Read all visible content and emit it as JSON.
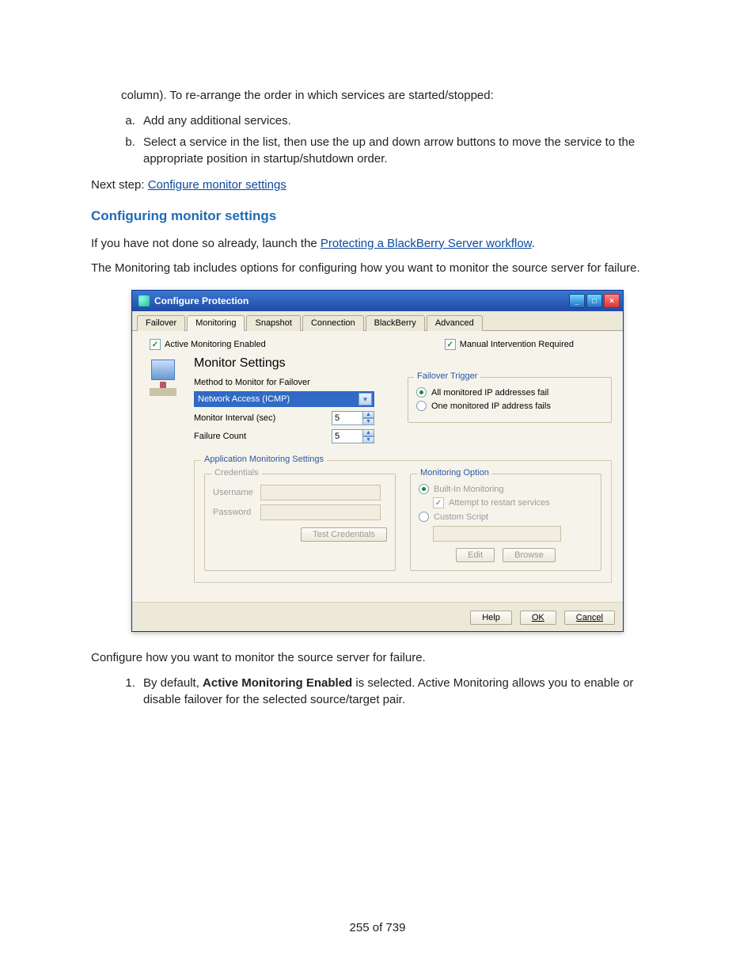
{
  "intro": {
    "line1": "column). To re-arrange the order in which services are started/stopped:",
    "sub_a": "Add any additional services.",
    "sub_b": "Select a service in the list, then use the up and down arrow buttons to move the service to the appropriate position in startup/shutdown order.",
    "next_step_prefix": "Next step: ",
    "next_step_link": "Configure monitor settings"
  },
  "heading": "Configuring monitor settings",
  "para1_prefix": "If you have not done so already, launch the ",
  "para1_link": "Protecting a BlackBerry Server workflow",
  "para1_suffix": ".",
  "para2": "The Monitoring tab includes options for configuring how you want to monitor the source server for failure.",
  "dialog": {
    "title": "Configure Protection",
    "tabs": [
      "Failover",
      "Monitoring",
      "Snapshot",
      "Connection",
      "BlackBerry",
      "Advanced"
    ],
    "active_tab": "Monitoring",
    "active_monitoring_label": "Active Monitoring Enabled",
    "manual_intervention_label": "Manual Intervention Required",
    "monitor_heading": "Monitor Settings",
    "method_label": "Method to Monitor for Failover",
    "method_value": "Network Access (ICMP)",
    "interval_label": "Monitor Interval (sec)",
    "interval_value": "5",
    "failure_count_label": "Failure Count",
    "failure_count_value": "5",
    "failover_trigger_legend": "Failover Trigger",
    "trigger_all": "All monitored IP addresses fail",
    "trigger_one": "One monitored IP address fails",
    "appmon_legend": "Application Monitoring Settings",
    "credentials_legend": "Credentials",
    "username_label": "Username",
    "password_label": "Password",
    "test_credentials": "Test Credentials",
    "monitoring_option_legend": "Monitoring Option",
    "builtin_label": "Built-In Monitoring",
    "attempt_restart": "Attempt to restart services",
    "custom_script": "Custom Script",
    "edit": "Edit",
    "browse": "Browse",
    "help": "Help",
    "ok": "OK",
    "cancel": "Cancel"
  },
  "after1": "Configure how you want to monitor the source server for failure.",
  "numbered_prefix": "By default, ",
  "numbered_bold": "Active Monitoring Enabled",
  "numbered_suffix": " is selected. Active Monitoring allows you to enable or disable failover for the selected source/target pair.",
  "footer": "255 of 739"
}
